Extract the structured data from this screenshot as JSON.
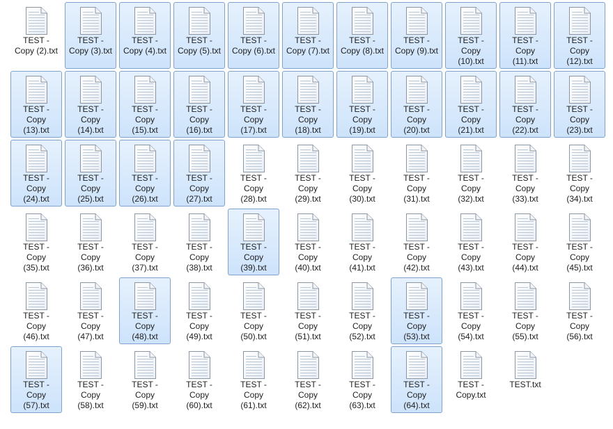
{
  "files": [
    {
      "name": "TEST -\nCopy (2).txt",
      "selected": false
    },
    {
      "name": "TEST -\nCopy (3).txt",
      "selected": true
    },
    {
      "name": "TEST -\nCopy (4).txt",
      "selected": true
    },
    {
      "name": "TEST -\nCopy (5).txt",
      "selected": true
    },
    {
      "name": "TEST -\nCopy (6).txt",
      "selected": true
    },
    {
      "name": "TEST -\nCopy (7).txt",
      "selected": true
    },
    {
      "name": "TEST -\nCopy (8).txt",
      "selected": true
    },
    {
      "name": "TEST -\nCopy (9).txt",
      "selected": true
    },
    {
      "name": "TEST -\nCopy\n(10).txt",
      "selected": true
    },
    {
      "name": "TEST -\nCopy\n(11).txt",
      "selected": true
    },
    {
      "name": "TEST -\nCopy\n(12).txt",
      "selected": true
    },
    {
      "name": "TEST -\nCopy\n(13).txt",
      "selected": true
    },
    {
      "name": "TEST -\nCopy\n(14).txt",
      "selected": true
    },
    {
      "name": "TEST -\nCopy\n(15).txt",
      "selected": true
    },
    {
      "name": "TEST -\nCopy\n(16).txt",
      "selected": true
    },
    {
      "name": "TEST -\nCopy\n(17).txt",
      "selected": true
    },
    {
      "name": "TEST -\nCopy\n(18).txt",
      "selected": true
    },
    {
      "name": "TEST -\nCopy\n(19).txt",
      "selected": true
    },
    {
      "name": "TEST -\nCopy\n(20).txt",
      "selected": true
    },
    {
      "name": "TEST -\nCopy\n(21).txt",
      "selected": true
    },
    {
      "name": "TEST -\nCopy\n(22).txt",
      "selected": true
    },
    {
      "name": "TEST -\nCopy\n(23).txt",
      "selected": true
    },
    {
      "name": "TEST -\nCopy\n(24).txt",
      "selected": true
    },
    {
      "name": "TEST -\nCopy\n(25).txt",
      "selected": true
    },
    {
      "name": "TEST -\nCopy\n(26).txt",
      "selected": true
    },
    {
      "name": "TEST -\nCopy\n(27).txt",
      "selected": true
    },
    {
      "name": "TEST -\nCopy\n(28).txt",
      "selected": false
    },
    {
      "name": "TEST -\nCopy\n(29).txt",
      "selected": false
    },
    {
      "name": "TEST -\nCopy\n(30).txt",
      "selected": false
    },
    {
      "name": "TEST -\nCopy\n(31).txt",
      "selected": false
    },
    {
      "name": "TEST -\nCopy\n(32).txt",
      "selected": false
    },
    {
      "name": "TEST -\nCopy\n(33).txt",
      "selected": false
    },
    {
      "name": "TEST -\nCopy\n(34).txt",
      "selected": false
    },
    {
      "name": "TEST -\nCopy\n(35).txt",
      "selected": false
    },
    {
      "name": "TEST -\nCopy\n(36).txt",
      "selected": false
    },
    {
      "name": "TEST -\nCopy\n(37).txt",
      "selected": false
    },
    {
      "name": "TEST -\nCopy\n(38).txt",
      "selected": false
    },
    {
      "name": "TEST -\nCopy\n(39).txt",
      "selected": true
    },
    {
      "name": "TEST -\nCopy\n(40).txt",
      "selected": false
    },
    {
      "name": "TEST -\nCopy\n(41).txt",
      "selected": false
    },
    {
      "name": "TEST -\nCopy\n(42).txt",
      "selected": false
    },
    {
      "name": "TEST -\nCopy\n(43).txt",
      "selected": false
    },
    {
      "name": "TEST -\nCopy\n(44).txt",
      "selected": false
    },
    {
      "name": "TEST -\nCopy\n(45).txt",
      "selected": false
    },
    {
      "name": "TEST -\nCopy\n(46).txt",
      "selected": false
    },
    {
      "name": "TEST -\nCopy\n(47).txt",
      "selected": false
    },
    {
      "name": "TEST -\nCopy\n(48).txt",
      "selected": true
    },
    {
      "name": "TEST -\nCopy\n(49).txt",
      "selected": false
    },
    {
      "name": "TEST -\nCopy\n(50).txt",
      "selected": false
    },
    {
      "name": "TEST -\nCopy\n(51).txt",
      "selected": false
    },
    {
      "name": "TEST -\nCopy\n(52).txt",
      "selected": false
    },
    {
      "name": "TEST -\nCopy\n(53).txt",
      "selected": true
    },
    {
      "name": "TEST -\nCopy\n(54).txt",
      "selected": false
    },
    {
      "name": "TEST -\nCopy\n(55).txt",
      "selected": false
    },
    {
      "name": "TEST -\nCopy\n(56).txt",
      "selected": false
    },
    {
      "name": "TEST -\nCopy\n(57).txt",
      "selected": true
    },
    {
      "name": "TEST -\nCopy\n(58).txt",
      "selected": false
    },
    {
      "name": "TEST -\nCopy\n(59).txt",
      "selected": false
    },
    {
      "name": "TEST -\nCopy\n(60).txt",
      "selected": false
    },
    {
      "name": "TEST -\nCopy\n(61).txt",
      "selected": false
    },
    {
      "name": "TEST -\nCopy\n(62).txt",
      "selected": false
    },
    {
      "name": "TEST -\nCopy\n(63).txt",
      "selected": false
    },
    {
      "name": "TEST -\nCopy\n(64).txt",
      "selected": true
    },
    {
      "name": "TEST -\nCopy.txt",
      "selected": false
    },
    {
      "name": "TEST.txt",
      "selected": false
    }
  ],
  "icon": "text-document-icon",
  "colors": {
    "selection_fill_top": "#e6f1fd",
    "selection_fill_bottom": "#cde3fb",
    "selection_border": "#7da2ce"
  }
}
